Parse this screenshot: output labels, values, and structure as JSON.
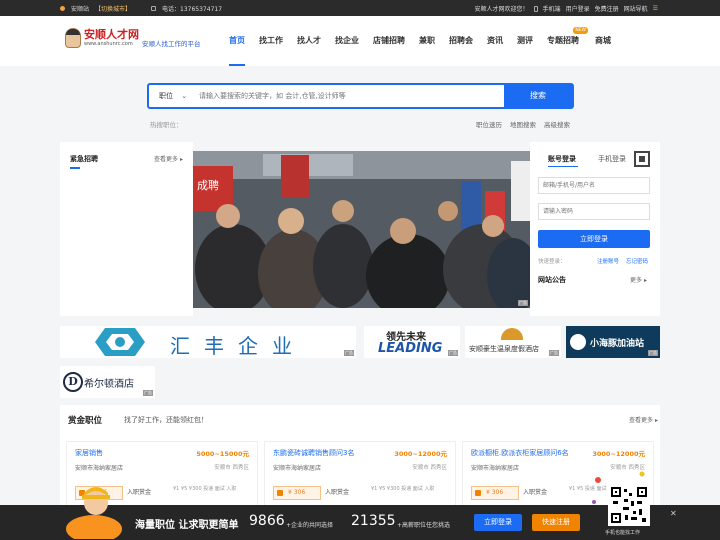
{
  "topbar": {
    "location": "安顺站",
    "switch_city": "【切换城市】",
    "phone": "电话：13765374717",
    "welcome": "安顺人才网欢迎您！",
    "mobile": "手机端",
    "login": "用户登录",
    "register": "免费注册",
    "site_nav": "网站导航"
  },
  "brand": {
    "title": "安顺人才网",
    "url": "www.anshunrc.com",
    "slogan": "安顺人找工作的平台"
  },
  "nav": {
    "items": [
      {
        "label": "首页"
      },
      {
        "label": "找工作"
      },
      {
        "label": "找人才"
      },
      {
        "label": "找企业"
      },
      {
        "label": "店铺招聘"
      },
      {
        "label": "兼职"
      },
      {
        "label": "招聘会"
      },
      {
        "label": "资讯"
      },
      {
        "label": "测评"
      },
      {
        "label": "专题招聘"
      },
      {
        "label": "商城"
      }
    ],
    "new_badge": "NEW"
  },
  "search": {
    "type_label": "职位",
    "placeholder": "请输入要搜索的关键字，如 会计,仓管,设计师等",
    "button": "搜索",
    "hot_label": "热搜职位：",
    "links": [
      "职位速历",
      "地图搜索",
      "高级搜索"
    ]
  },
  "urgent": {
    "title": "紧急招聘",
    "more": "查看更多"
  },
  "ad_tag": "广告",
  "login_box": {
    "tab_account": "账号登录",
    "tab_mobile": "手机登录",
    "user_placeholder": "邮箱/手机号/用户名",
    "pass_placeholder": "请输入密码",
    "submit": "立即登录",
    "quick": "快速登录：",
    "register": "注册账号",
    "forgot": "忘记密码"
  },
  "announce": {
    "title": "网站公告",
    "more": "更多"
  },
  "ads": {
    "huifeng": "汇丰企业",
    "leading_cn": "领先未来",
    "leading_en": "LEADING",
    "hotspring": "安顺豪生温泉度假酒店",
    "dolphin": "小海豚加油站",
    "hilton": "希尔顿酒店"
  },
  "reward": {
    "title": "赏金职位",
    "subtitle": "找了好工作，还能领红包！",
    "more": "查看更多",
    "jobs": [
      {
        "title": "家居销售",
        "salary": "5000~15000元",
        "company": "安顺市海纳家居店",
        "area": "安顺市 西秀区",
        "bonus": "¥ 306",
        "ruzhi": "入职赏金",
        "steps": "¥1   ¥5   ¥300 投递 面试 入职"
      },
      {
        "title": "东鹏瓷砖诚聘销售顾问3名",
        "salary": "3000~12000元",
        "company": "安顺市海纳家居店",
        "area": "安顺市 西秀区",
        "bonus": "¥ 306",
        "ruzhi": "入职赏金",
        "steps": "¥1   ¥5   ¥300 投递 面试 入职"
      },
      {
        "title": "欧派橱柜.欧派衣柜家居顾问6名",
        "salary": "3000~12000元",
        "company": "安顺市海纳家居店",
        "area": "安顺市 西秀区",
        "bonus": "¥ 306",
        "ruzhi": "入职赏金",
        "steps": "¥1   ¥5 投递 面试"
      }
    ]
  },
  "footer": {
    "headline": "海量职位 让求职更简单",
    "num1": "9866",
    "lab1": "+企业的共同选择",
    "num2": "21355",
    "lab2": "+高薪职位任您挑选",
    "btn_login": "立即登录",
    "btn_register": "快速注册",
    "qr_caption": "手机也能找工作",
    "close": "✕"
  },
  "colors": {
    "primary": "#1b6cf2",
    "salary": "#f08300",
    "topbar": "#2b2b2b"
  }
}
